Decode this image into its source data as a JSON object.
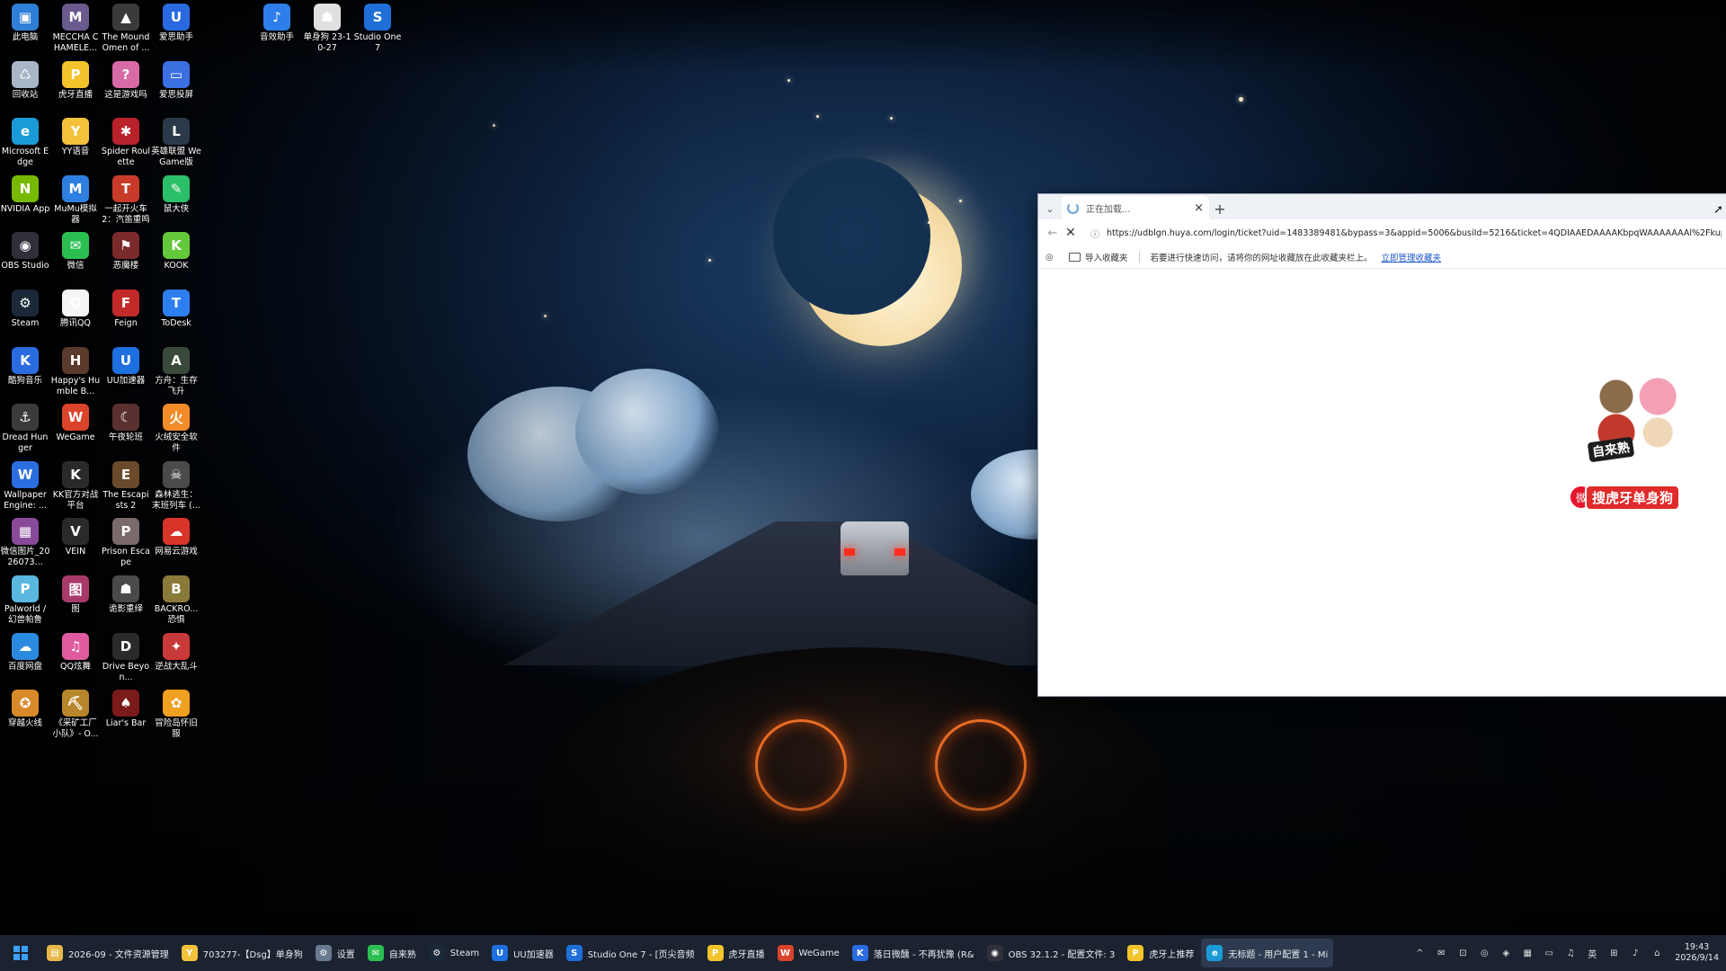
{
  "desktop_icons": [
    {
      "label": "此电脑",
      "color": "#2f7fd8",
      "glyph": "▣"
    },
    {
      "label": "MECCHA CHAMELE...",
      "color": "#6b5a8e",
      "glyph": "M"
    },
    {
      "label": "The Mound Omen of ...",
      "color": "#3a3a3a",
      "glyph": "▲"
    },
    {
      "label": "爱思助手",
      "color": "#2a6ae0",
      "glyph": "U"
    },
    {
      "label": "音效助手",
      "color": "#2d7ee8",
      "glyph": "♪"
    },
    {
      "label": "单身狗 23-10-27",
      "color": "#e0e0e0",
      "glyph": "☗"
    },
    {
      "label": "Studio One 7",
      "color": "#1e6fd8",
      "glyph": "S"
    },
    {
      "label": "回收站",
      "color": "#a8b6c8",
      "glyph": "♺"
    },
    {
      "label": "虎牙直播",
      "color": "#f2c32a",
      "glyph": "P"
    },
    {
      "label": "这是游戏吗",
      "color": "#d86aa8",
      "glyph": "?"
    },
    {
      "label": "爱思投屏",
      "color": "#3b6fe2",
      "glyph": "▭"
    },
    {
      "label": "Microsoft Edge",
      "color": "#1a9bd7",
      "glyph": "e"
    },
    {
      "label": "YY语音",
      "color": "#f3c23a",
      "glyph": "Y"
    },
    {
      "label": "Spider Roulette",
      "color": "#b8222a",
      "glyph": "✱"
    },
    {
      "label": "英雄联盟 WeGame版",
      "color": "#2b3a4a",
      "glyph": "L"
    },
    {
      "label": "NVIDIA App",
      "color": "#76b900",
      "glyph": "N"
    },
    {
      "label": "MuMu模拟器",
      "color": "#2d7fe0",
      "glyph": "M"
    },
    {
      "label": "一起开火车2：汽笛重鸣",
      "color": "#c83b2a",
      "glyph": "T"
    },
    {
      "label": "鼠大侠",
      "color": "#2cbf6a",
      "glyph": "✎"
    },
    {
      "label": "OBS Studio",
      "color": "#30303a",
      "glyph": "◉"
    },
    {
      "label": "微信",
      "color": "#2bbf52",
      "glyph": "✉"
    },
    {
      "label": "恶魔楼",
      "color": "#7a2a2a",
      "glyph": "⚑"
    },
    {
      "label": "KOOK",
      "color": "#63c83a",
      "glyph": "K"
    },
    {
      "label": "Steam",
      "color": "#1b2838",
      "glyph": "⚙"
    },
    {
      "label": "腾讯QQ",
      "color": "#f5f5f5",
      "glyph": "Q"
    },
    {
      "label": "Feign",
      "color": "#c22a2a",
      "glyph": "F"
    },
    {
      "label": "ToDesk",
      "color": "#2d7ef0",
      "glyph": "T"
    },
    {
      "label": "酷狗音乐",
      "color": "#2b6be0",
      "glyph": "K"
    },
    {
      "label": "Happy's Humble B...",
      "color": "#5a3a2a",
      "glyph": "H"
    },
    {
      "label": "UU加速器",
      "color": "#1e6fe0",
      "glyph": "U"
    },
    {
      "label": "方舟：生存飞升",
      "color": "#3a4a3a",
      "glyph": "A"
    },
    {
      "label": "Dread Hunger",
      "color": "#3a3a3a",
      "glyph": "⚓"
    },
    {
      "label": "WeGame",
      "color": "#d9442a",
      "glyph": "W"
    },
    {
      "label": "午夜轮班",
      "color": "#5a3030",
      "glyph": "☾"
    },
    {
      "label": "火绒安全软件",
      "color": "#f28c28",
      "glyph": "火"
    },
    {
      "label": "Wallpaper Engine: ...",
      "color": "#2b6ee0",
      "glyph": "W"
    },
    {
      "label": "KK官方对战平台",
      "color": "#2a2a2a",
      "glyph": "K"
    },
    {
      "label": "The Escapists 2",
      "color": "#6a4a2a",
      "glyph": "E"
    },
    {
      "label": "森林逃生：末班列车 (...",
      "color": "#4a4a4a",
      "glyph": "☠"
    },
    {
      "label": "微信图片_2026073...",
      "color": "#8a4a9a",
      "glyph": "▦"
    },
    {
      "label": "VEIN",
      "color": "#2a2a2a",
      "glyph": "V"
    },
    {
      "label": "Prison Escape",
      "color": "#7a6a6a",
      "glyph": "P"
    },
    {
      "label": "网易云游戏",
      "color": "#d8342a",
      "glyph": "☁"
    },
    {
      "label": "Palworld / 幻兽帕鲁",
      "color": "#5ab8e0",
      "glyph": "P"
    },
    {
      "label": "图",
      "color": "#a83a6a",
      "glyph": "图"
    },
    {
      "label": "诡影重绎",
      "color": "#4a4a4a",
      "glyph": "☗"
    },
    {
      "label": "BACKRO... 恐惧",
      "color": "#8a7a3a",
      "glyph": "B"
    },
    {
      "label": "百度网盘",
      "color": "#2a8ae0",
      "glyph": "☁"
    },
    {
      "label": "QQ炫舞",
      "color": "#e05aa0",
      "glyph": "♫"
    },
    {
      "label": "Drive Beyon...",
      "color": "#2a2a2a",
      "glyph": "D"
    },
    {
      "label": "逆战大乱斗",
      "color": "#c83a3a",
      "glyph": "✦"
    },
    {
      "label": "穿越火线",
      "color": "#d88a2a",
      "glyph": "✪"
    },
    {
      "label": "《采矿工厂小队》- O...",
      "color": "#b8862a",
      "glyph": "⛏"
    },
    {
      "label": "Liar's Bar",
      "color": "#7a1a1a",
      "glyph": "♠"
    },
    {
      "label": "冒险岛怀旧服",
      "color": "#f0a020",
      "glyph": "✿"
    }
  ],
  "browser": {
    "tab_title": "正在加载...",
    "tab_close": "×",
    "new_tab": "+",
    "tab_list": "⌄",
    "back": "←",
    "stop": "✕",
    "info": "ⓘ",
    "url": "https://udblgn.huya.com/login/ticket?uid=1483389481&bypass=3&appid=5006&busiId=5216&ticket=4QDIAAEDAAAAKbpqWAAAAAAAl%2Fkup",
    "fav_import": "导入收藏夹",
    "fav_hint": "若要进行快速访问，请将你的网址收藏放在此收藏夹栏上。",
    "fav_link": "立即管理收藏夹",
    "mascot_tag1": "自来熟",
    "mascot_tag2": "搜虎牙单身狗"
  },
  "taskbar": {
    "items": [
      {
        "label": "2026-09 - 文件资源管理",
        "color": "#e6b84a",
        "glyph": "▤",
        "active": false
      },
      {
        "label": "703277-【Dsg】单身狗",
        "color": "#f3c23a",
        "glyph": "Y",
        "active": false
      },
      {
        "label": "设置",
        "color": "#6a7a8e",
        "glyph": "⚙",
        "active": false
      },
      {
        "label": "自来熟",
        "color": "#2bbf52",
        "glyph": "✉",
        "active": false
      },
      {
        "label": "Steam",
        "color": "#1b2838",
        "glyph": "⚙",
        "active": false
      },
      {
        "label": "UU加速器",
        "color": "#1e6fe0",
        "glyph": "U",
        "active": false
      },
      {
        "label": "Studio One 7 - [页尖音频",
        "color": "#1e6fd8",
        "glyph": "S",
        "active": false
      },
      {
        "label": "虎牙直播",
        "color": "#f2c32a",
        "glyph": "P",
        "active": false
      },
      {
        "label": "WeGame",
        "color": "#d9442a",
        "glyph": "W",
        "active": false
      },
      {
        "label": "落日微醺 - 不再犹豫 (R&",
        "color": "#2b6be0",
        "glyph": "K",
        "active": false
      },
      {
        "label": "OBS 32.1.2 - 配置文件: 3",
        "color": "#30303a",
        "glyph": "◉",
        "active": false
      },
      {
        "label": "虎牙上推荐",
        "color": "#f2c32a",
        "glyph": "P",
        "active": false
      },
      {
        "label": "无标题 - 用户配置 1 - Mi",
        "color": "#1a9bd7",
        "glyph": "e",
        "active": true
      }
    ],
    "tray": [
      "^",
      "✉",
      "⊡",
      "◎",
      "◈",
      "▦",
      "▭",
      "♫",
      "英",
      "⊞",
      "♪",
      "⌂"
    ],
    "time": "19:43",
    "date": "2026/9/14"
  }
}
